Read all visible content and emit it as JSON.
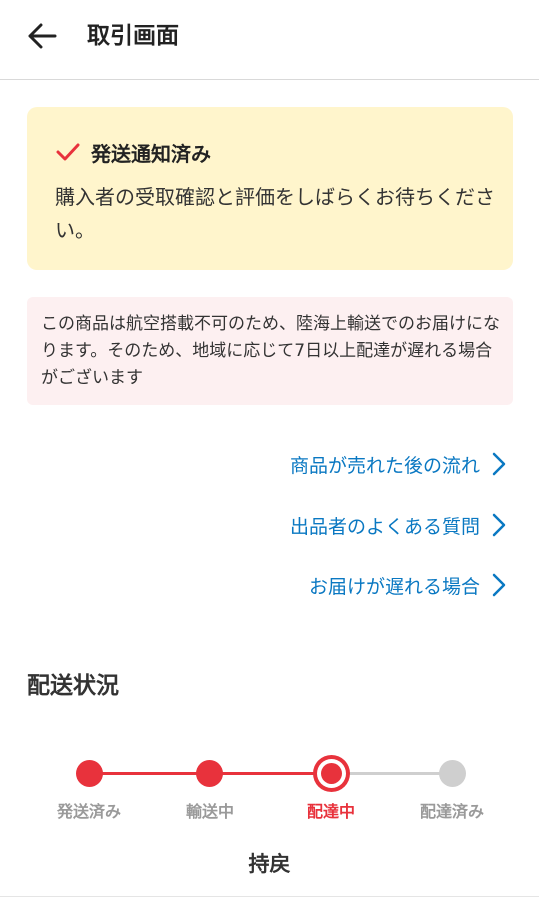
{
  "header": {
    "title": "取引画面",
    "back_icon": "arrow-left-icon"
  },
  "notice": {
    "title": "発送通知済み",
    "body": "購入者の受取確認と評価をしばらくお待ちください。",
    "icon": "checkmark-icon",
    "accent_color": "#e8323c"
  },
  "warning": {
    "text": "この商品は航空搭載不可のため、陸海上輸送でのお届けになります。そのため、地域に応じて7日以上配達が遅れる場合がございます"
  },
  "links": [
    {
      "label": "商品が売れた後の流れ"
    },
    {
      "label": "出品者のよくある質問"
    },
    {
      "label": "お届けが遅れる場合"
    }
  ],
  "delivery": {
    "title": "配送状況",
    "steps": [
      {
        "label": "発送済み",
        "state": "done"
      },
      {
        "label": "輸送中",
        "state": "done"
      },
      {
        "label": "配達中",
        "state": "current"
      },
      {
        "label": "配達済み",
        "state": "pending"
      }
    ],
    "active_color": "#e8323c",
    "inactive_color": "#cfcfcf"
  },
  "bottom": {
    "title": "持戻"
  }
}
